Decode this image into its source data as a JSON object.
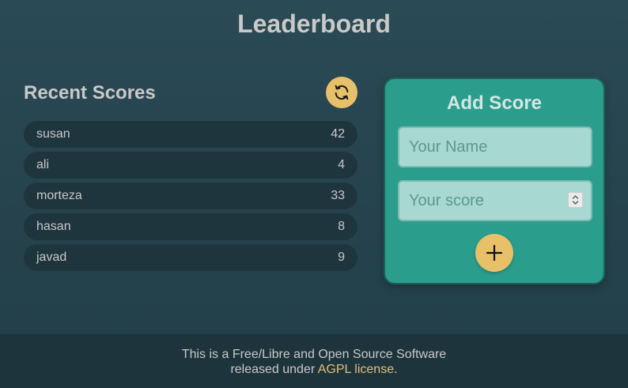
{
  "header": {
    "title": "Leaderboard"
  },
  "scores": {
    "title": "Recent Scores",
    "refresh_icon": "refresh-icon",
    "items": [
      {
        "name": "susan",
        "score": "42"
      },
      {
        "name": "ali",
        "score": "4"
      },
      {
        "name": "morteza",
        "score": "33"
      },
      {
        "name": "hasan",
        "score": "8"
      },
      {
        "name": "javad",
        "score": "9"
      }
    ]
  },
  "add_score": {
    "title": "Add Score",
    "name_placeholder": "Your Name",
    "score_placeholder": "Your score",
    "add_icon": "plus-icon"
  },
  "footer": {
    "line1": "This is a Free/Libre and Open Source Software",
    "line2_prefix": "released under ",
    "license_link": "AGPL license",
    "line2_suffix": "."
  },
  "colors": {
    "accent": "#e8c06a",
    "card": "#2a9d8c",
    "row": "#1f353e",
    "background": "#26434d"
  }
}
